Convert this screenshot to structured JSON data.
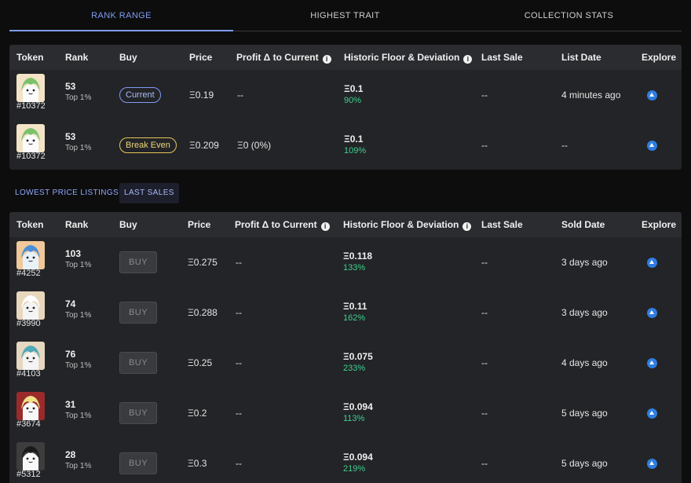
{
  "tabs": [
    "RANK RANGE",
    "HIGHEST TRAIT",
    "COLLECTION STATS"
  ],
  "top_table": {
    "headers": [
      "Token",
      "Rank",
      "Buy",
      "Price",
      "Profit Δ to Current",
      "Historic Floor & Deviation",
      "Last Sale",
      "List Date",
      "Explore"
    ],
    "rows": [
      {
        "token": "#10372",
        "rank": "53",
        "rank_sub": "Top 1%",
        "buy": "Current",
        "price": "Ξ0.19",
        "profit": "--",
        "floor": "Ξ0.1",
        "dev": "90%",
        "last_sale": "--",
        "date": "4 minutes ago",
        "avatar": "green-hair"
      },
      {
        "token": "#10372",
        "rank": "53",
        "rank_sub": "Top 1%",
        "buy": "Break Even",
        "price": "Ξ0.209",
        "profit": "Ξ0 (0%)",
        "floor": "Ξ0.1",
        "dev": "109%",
        "last_sale": "--",
        "date": "--",
        "avatar": "green-hair"
      }
    ]
  },
  "subtabs": [
    "LOWEST PRICE LISTINGS",
    "LAST SALES"
  ],
  "bottom_table": {
    "headers": [
      "Token",
      "Rank",
      "Buy",
      "Price",
      "Profit Δ to Current",
      "Historic Floor & Deviation",
      "Last Sale",
      "Sold Date",
      "Explore"
    ],
    "buy_label": "BUY",
    "rows": [
      {
        "token": "#4252",
        "rank": "103",
        "rank_sub": "Top 1%",
        "price": "Ξ0.275",
        "profit": "--",
        "floor": "Ξ0.118",
        "dev": "133%",
        "last_sale": "--",
        "date": "3 days ago",
        "avatar": "blue-cat"
      },
      {
        "token": "#3990",
        "rank": "74",
        "rank_sub": "Top 1%",
        "price": "Ξ0.288",
        "profit": "--",
        "floor": "Ξ0.11",
        "dev": "162%",
        "last_sale": "--",
        "date": "3 days ago",
        "avatar": "white-hair"
      },
      {
        "token": "#4103",
        "rank": "76",
        "rank_sub": "Top 1%",
        "price": "Ξ0.25",
        "profit": "--",
        "floor": "Ξ0.075",
        "dev": "233%",
        "last_sale": "--",
        "date": "4 days ago",
        "avatar": "teal-hair"
      },
      {
        "token": "#3674",
        "rank": "31",
        "rank_sub": "Top 1%",
        "price": "Ξ0.2",
        "profit": "--",
        "floor": "Ξ0.094",
        "dev": "113%",
        "last_sale": "--",
        "date": "5 days ago",
        "avatar": "red-bg"
      },
      {
        "token": "#5312",
        "rank": "28",
        "rank_sub": "Top 1%",
        "price": "Ξ0.3",
        "profit": "--",
        "floor": "Ξ0.094",
        "dev": "219%",
        "last_sale": "--",
        "date": "5 days ago",
        "avatar": "dark-bg"
      }
    ]
  },
  "colors": {
    "accent": "#7f9cf5",
    "positive": "#3ecf8e",
    "break_even": "#e6c65a",
    "explore": "#2f7de1"
  }
}
